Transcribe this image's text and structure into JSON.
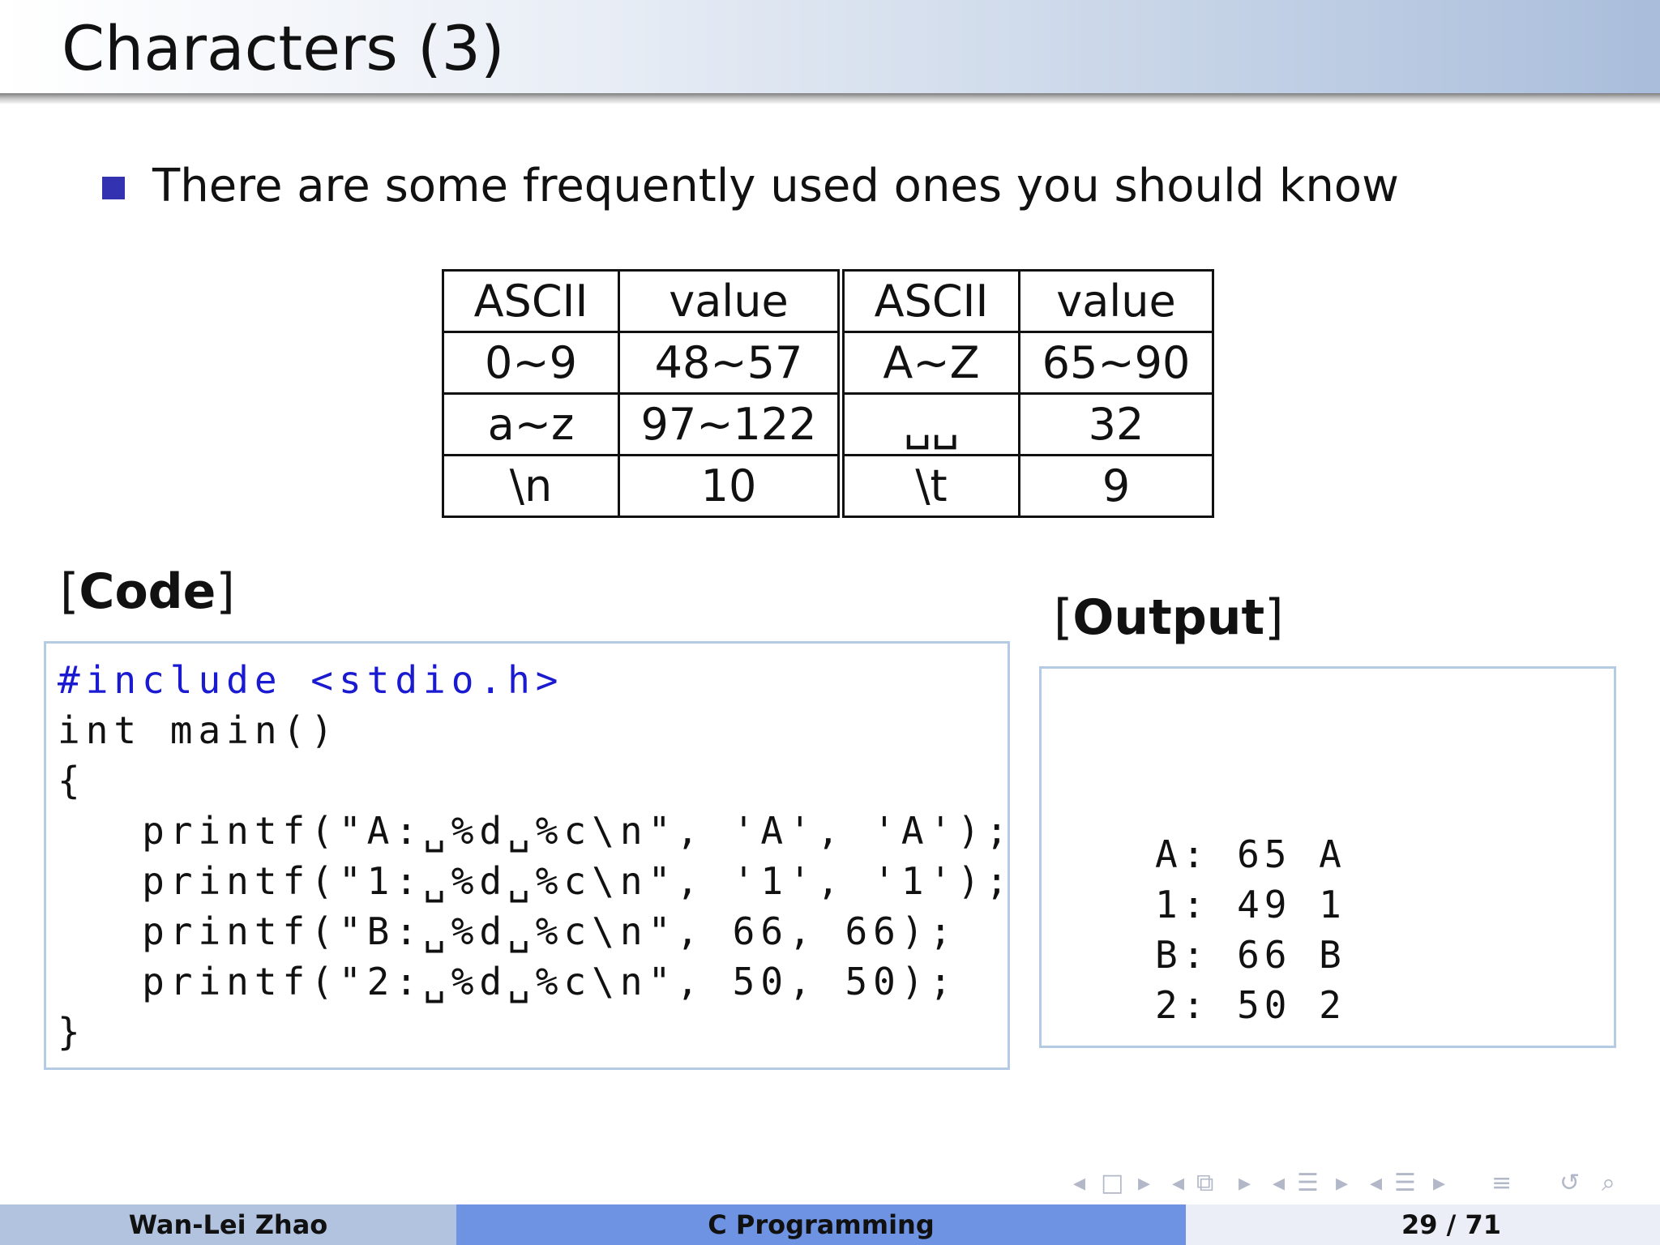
{
  "slide": {
    "title": "Characters (3)",
    "bullet": "There are some frequently used ones you should know"
  },
  "table": {
    "headers": [
      "ASCII",
      "value",
      "ASCII",
      "value"
    ],
    "rows": [
      [
        "0∼9",
        "48∼57",
        "A∼Z",
        "65∼90"
      ],
      [
        "a∼z",
        "97∼122",
        "␣␣",
        "32"
      ],
      [
        "\\n",
        "10",
        "\\t",
        "9"
      ]
    ]
  },
  "code_section": {
    "label": "Code",
    "lines": [
      "#include <stdio.h>",
      "int main()",
      "{",
      "   printf(\"A:␣%d␣%c\\n\", 'A', 'A');",
      "   printf(\"1:␣%d␣%c\\n\", '1', '1');",
      "   printf(\"B:␣%d␣%c\\n\", 66, 66);",
      "   printf(\"2:␣%d␣%c\\n\", 50, 50);",
      "}"
    ]
  },
  "output_section": {
    "label": "Output",
    "lines": [
      "A: 65 A",
      "1: 49 1",
      "B: 66 B",
      "2: 50 2"
    ]
  },
  "nav_icons": [
    "arrow-left-icon",
    "frame-icon",
    "arrow-right-icon",
    "arrow-left-icon",
    "subsection-icon",
    "arrow-right-icon",
    "arrow-left-icon",
    "section-icon",
    "arrow-right-icon",
    "arrow-left-icon",
    "section-icon",
    "arrow-right-icon",
    "align-icon",
    "loop-icon",
    "search-icon"
  ],
  "footer": {
    "author": "Wan-Lei Zhao",
    "course": "C Programming",
    "page": "29 / 71"
  },
  "colors": {
    "bullet": "#3333b2",
    "keyword": "#1a1ad1",
    "box_border": "#b4cbe3",
    "footer_left": "#b2c3e0",
    "footer_mid": "#6f93e3"
  }
}
